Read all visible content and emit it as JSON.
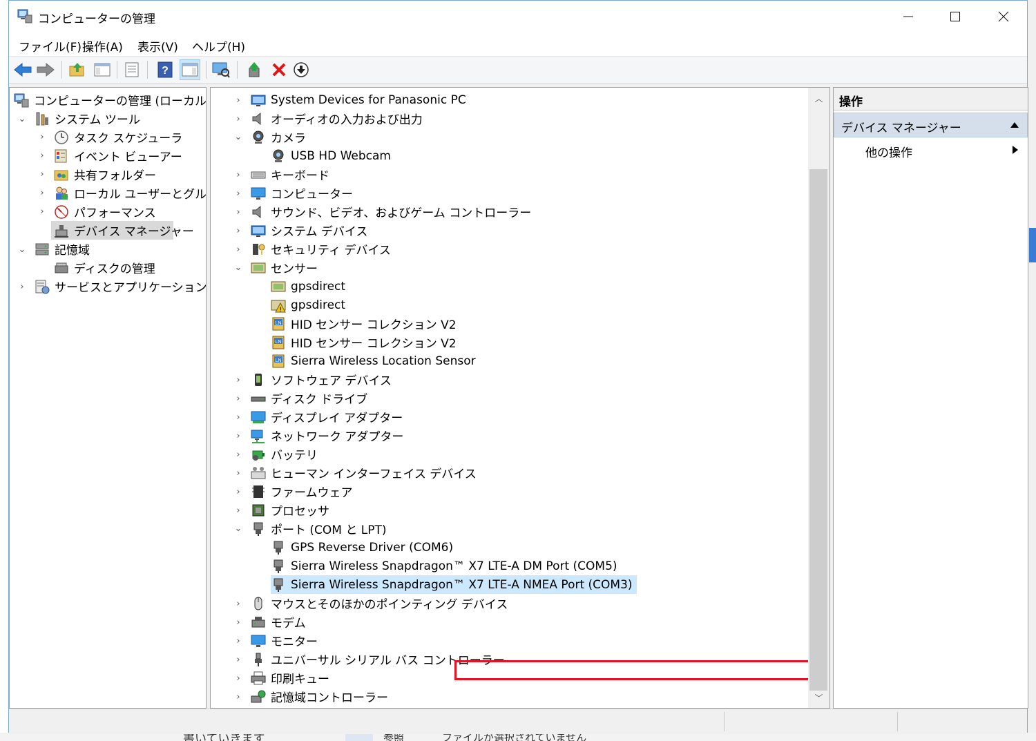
{
  "window": {
    "title": "コンピューターの管理"
  },
  "menu": [
    "ファイル(F)",
    "操作(A)",
    "表示(V)",
    "ヘルプ(H)"
  ],
  "tree": [
    {
      "label": "コンピューターの管理 (ローカル)",
      "icon": "computer-management-icon"
    },
    {
      "label": "システム ツール",
      "icon": "system-tools-icon"
    },
    {
      "label": "タスク スケジューラ",
      "icon": "clock-icon"
    },
    {
      "label": "イベント ビューアー",
      "icon": "event-viewer-icon"
    },
    {
      "label": "共有フォルダー",
      "icon": "shared-folder-icon"
    },
    {
      "label": "ローカル ユーザーとグループ",
      "icon": "users-icon"
    },
    {
      "label": "パフォーマンス",
      "icon": "performance-icon"
    },
    {
      "label": "デバイス マネージャー",
      "icon": "device-manager-icon"
    },
    {
      "label": "記憶域",
      "icon": "storage-icon"
    },
    {
      "label": "ディスクの管理",
      "icon": "disk-management-icon"
    },
    {
      "label": "サービスとアプリケーション",
      "icon": "services-icon"
    }
  ],
  "devices": [
    {
      "label": "System Devices for Panasonic PC",
      "icon": "system-device-icon"
    },
    {
      "label": "オーディオの入力および出力",
      "icon": "speaker-icon"
    },
    {
      "label": "カメラ",
      "icon": "webcam-icon"
    },
    {
      "label": "USB HD Webcam",
      "icon": "webcam-icon"
    },
    {
      "label": "キーボード",
      "icon": "keyboard-icon"
    },
    {
      "label": "コンピューター",
      "icon": "monitor-icon"
    },
    {
      "label": "サウンド、ビデオ、およびゲーム コントローラー",
      "icon": "speaker-icon"
    },
    {
      "label": "システム デバイス",
      "icon": "system-device-icon"
    },
    {
      "label": "セキュリティ デバイス",
      "icon": "security-key-icon"
    },
    {
      "label": "センサー",
      "icon": "sensor-icon"
    },
    {
      "label": "gpsdirect",
      "icon": "sensor-icon"
    },
    {
      "label": "gpsdirect",
      "icon": "sensor-warning-icon"
    },
    {
      "label": "HID センサー コレクション V2",
      "icon": "hid-sensor-icon"
    },
    {
      "label": "HID センサー コレクション V2",
      "icon": "hid-sensor-icon"
    },
    {
      "label": "Sierra Wireless Location Sensor",
      "icon": "hid-sensor-icon"
    },
    {
      "label": "ソフトウェア デバイス",
      "icon": "software-device-icon"
    },
    {
      "label": "ディスク ドライブ",
      "icon": "disk-drive-icon"
    },
    {
      "label": "ディスプレイ アダプター",
      "icon": "display-adapter-icon"
    },
    {
      "label": "ネットワーク アダプター",
      "icon": "network-adapter-icon"
    },
    {
      "label": "バッテリ",
      "icon": "battery-icon"
    },
    {
      "label": "ヒューマン インターフェイス デバイス",
      "icon": "hid-icon"
    },
    {
      "label": "ファームウェア",
      "icon": "firmware-icon"
    },
    {
      "label": "プロセッサ",
      "icon": "processor-icon"
    },
    {
      "label": "ポート (COM と LPT)",
      "icon": "port-icon"
    },
    {
      "label": "GPS Reverse Driver (COM6)",
      "icon": "port-icon"
    },
    {
      "label": "Sierra Wireless Snapdragon™ X7 LTE-A DM Port (COM5)",
      "icon": "port-icon"
    },
    {
      "label": "Sierra Wireless Snapdragon™ X7 LTE-A NMEA Port (COM3)",
      "icon": "port-icon"
    },
    {
      "label": "マウスとそのほかのポインティング デバイス",
      "icon": "mouse-icon"
    },
    {
      "label": "モデム",
      "icon": "modem-icon"
    },
    {
      "label": "モニター",
      "icon": "monitor-icon"
    },
    {
      "label": "ユニバーサル シリアル バス コントローラー",
      "icon": "usb-icon"
    },
    {
      "label": "印刷キュー",
      "icon": "printer-icon"
    },
    {
      "label": "記憶域コントローラー",
      "icon": "storage-controller-icon"
    }
  ],
  "actions": {
    "header": "操作",
    "section": "デバイス マネージャー",
    "item": "他の操作"
  },
  "background": {
    "text1": "書いていきます",
    "text2": "参照",
    "text3": "ファイルが選択されていません"
  }
}
